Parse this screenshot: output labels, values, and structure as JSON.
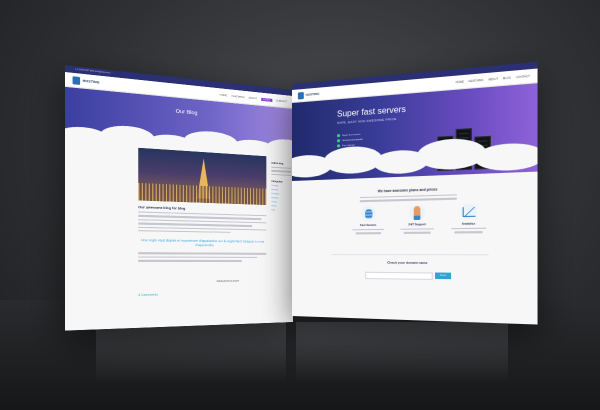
{
  "left_page": {
    "topbar_text": "+1 (234) 567 890   info@site.com",
    "logo_text": "HOSTING",
    "nav": [
      "HOME",
      "FEATURES",
      "ABOUT",
      "BLOG",
      "CONTACT"
    ],
    "active_nav": "BLOG",
    "hero_title": "Our Blog",
    "hero_subtitle": "",
    "post_title": "Our awesome blog for blog",
    "post_meta": "",
    "quote": "Une regle vaut depuis et superieure d'apprendre sur le reglement lorsque tu vois d'apprendre",
    "tags": "#default  #tech  #web",
    "comments_heading": "2 Comments",
    "sidebar": {
      "heading1": "Article blog",
      "heading2": "Categories",
      "links": [
        "Hosting",
        "Servers",
        "Domains",
        "Support",
        "Cloud",
        "News",
        "Tips"
      ]
    }
  },
  "right_page": {
    "logo_text": "HOSTING",
    "nav": [
      "HOME",
      "FEATURES",
      "ABOUT",
      "BLOG",
      "CONTACT"
    ],
    "hero_title": "Super fast servers",
    "hero_subtitle": "SAFE, EASY AND AWESOME PRICE",
    "checks": [
      "Super fast servers",
      "Unlimited bandwidth",
      "Free domain",
      "Easy backup"
    ],
    "section_title": "We have awesome plans and prices",
    "features": [
      {
        "title": "Fast Servers",
        "icon": "database-icon"
      },
      {
        "title": "24/7 Support",
        "icon": "support-person-icon"
      },
      {
        "title": "Analytics",
        "icon": "growth-chart-icon"
      }
    ],
    "domain_title": "Check your domain name",
    "domain_button": "Search"
  },
  "colors": {
    "background": "#2e3033",
    "hero_purple": "#6a4cc0",
    "accent_blue": "#2ea3d6"
  }
}
